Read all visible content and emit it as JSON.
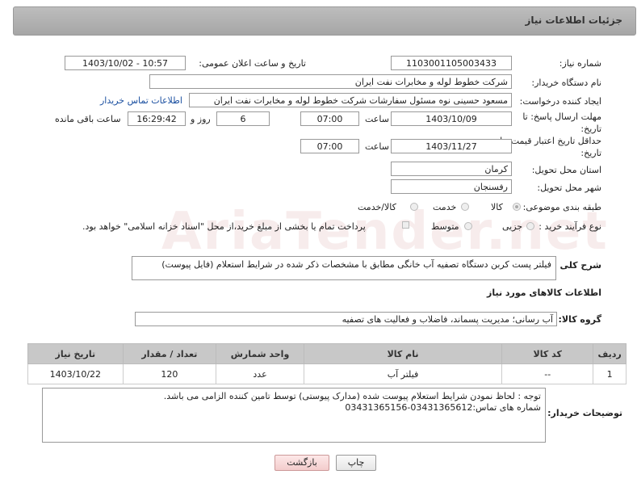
{
  "header": {
    "title": "جزئیات اطلاعات نیاز"
  },
  "watermark": "AriaTender.net",
  "fields": {
    "need_number": {
      "label": "شماره نیاز:",
      "value": "1103001105003433"
    },
    "announce_datetime": {
      "label": "تاریخ و ساعت اعلان عمومی:",
      "value": "1403/10/02 - 10:57"
    },
    "buyer_org": {
      "label": "نام دستگاه خریدار:",
      "value": "شرکت خطوط لوله و مخابرات نفت ایران"
    },
    "requester": {
      "label": "ایجاد کننده درخواست:",
      "value": "مسعود حسینی نوه  مسئول سفارشات  شرکت خطوط لوله و مخابرات نفت ایران",
      "contact_link": "اطلاعات تماس خریدار"
    },
    "reply_deadline": {
      "label": "مهلت ارسال پاسخ: تا تاریخ:",
      "date": "1403/10/09",
      "time_label": "ساعت",
      "time": "07:00",
      "days": "6",
      "days_label": "روز و",
      "remaining": "16:29:42",
      "remaining_label": "ساعت باقی مانده"
    },
    "price_validity": {
      "label": "حداقل تاریخ اعتبار قیمت: تا تاریخ:",
      "date": "1403/11/27",
      "time_label": "ساعت",
      "time": "07:00"
    },
    "province": {
      "label": "استان محل تحویل:",
      "value": "کرمان"
    },
    "city": {
      "label": "شهر محل تحویل:",
      "value": "رفسنجان"
    },
    "category": {
      "label": "طبقه بندی موضوعی:",
      "options": [
        "کالا",
        "خدمت",
        "کالا/خدمت"
      ]
    },
    "process": {
      "label": "نوع فرآیند خرید :",
      "options": [
        "جزیی",
        "متوسط"
      ],
      "treasury_note": "پرداخت تمام یا بخشی از مبلغ خرید،از محل \"اسناد خزانه اسلامی\" خواهد بود."
    }
  },
  "description": {
    "label": "شرح کلی نیاز:",
    "value": "فیلتر پست کربن دستگاه تصفیه آب خانگی مطابق با مشخصات ذکر شده در شرایط استعلام (فایل پیوست)"
  },
  "goods_section_title": "اطلاعات کالاهای مورد نیاز",
  "goods_group": {
    "label": "گروه کالا:",
    "value": "آب رسانی؛ مدیریت پسماند، فاضلاب و فعالیت های تصفیه"
  },
  "table": {
    "headers": [
      "ردیف",
      "کد کالا",
      "نام کالا",
      "واحد شمارش",
      "تعداد / مقدار",
      "تاریخ نیاز"
    ],
    "rows": [
      [
        "1",
        "--",
        "فیلتر آب",
        "عدد",
        "120",
        "1403/10/22"
      ]
    ]
  },
  "buyer_notes": {
    "label": "توضیحات خریدار:",
    "line1": "توجه : لحاظ نمودن شرایط استعلام پیوست شده (مدارک پیوستی) توسط تامین کننده الزامی می باشد.",
    "line2": "شماره های تماس:03431365612-03431365156"
  },
  "buttons": {
    "print": "چاپ",
    "back": "بازگشت"
  }
}
